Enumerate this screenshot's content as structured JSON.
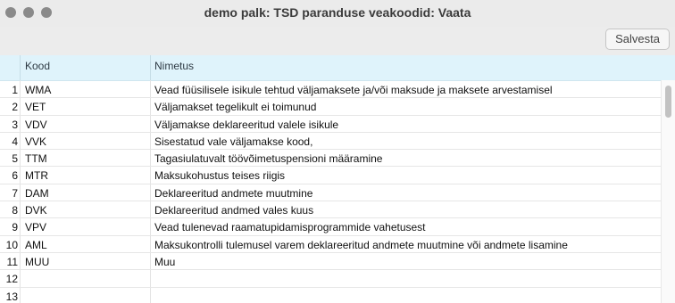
{
  "window": {
    "title": "demo palk: TSD paranduse veakoodid: Vaata"
  },
  "toolbar": {
    "save_label": "Salvesta"
  },
  "table": {
    "columns": [
      "Kood",
      "Nimetus"
    ],
    "rows": [
      {
        "n": "1",
        "code": "WMA",
        "name": "Vead füüsilisele isikule tehtud väljamaksete ja/või maksude ja maksete arvestamisel"
      },
      {
        "n": "2",
        "code": "VET",
        "name": "Väljamakset tegelikult ei toimunud"
      },
      {
        "n": "3",
        "code": "VDV",
        "name": "Väljamakse deklareeritud valele isikule"
      },
      {
        "n": "4",
        "code": "VVK",
        "name": "Sisestatud vale väljamakse kood,"
      },
      {
        "n": "5",
        "code": "TTM",
        "name": "Tagasiulatuvalt töövõimetuspensioni määramine"
      },
      {
        "n": "6",
        "code": "MTR",
        "name": "Maksukohustus teises riigis"
      },
      {
        "n": "7",
        "code": "DAM",
        "name": "Deklareeritud andmete muutmine"
      },
      {
        "n": "8",
        "code": "DVK",
        "name": "Deklareeritud andmed vales kuus"
      },
      {
        "n": "9",
        "code": "VPV",
        "name": "Vead tulenevad raamatupidamisprogrammide vahetusest"
      },
      {
        "n": "10",
        "code": "AML",
        "name": "Maksukontrolli tulemusel varem deklareeritud andmete muutmine või andmete lisamine"
      },
      {
        "n": "11",
        "code": "MUU",
        "name": "Muu"
      },
      {
        "n": "12",
        "code": "",
        "name": ""
      },
      {
        "n": "13",
        "code": "",
        "name": ""
      }
    ]
  }
}
